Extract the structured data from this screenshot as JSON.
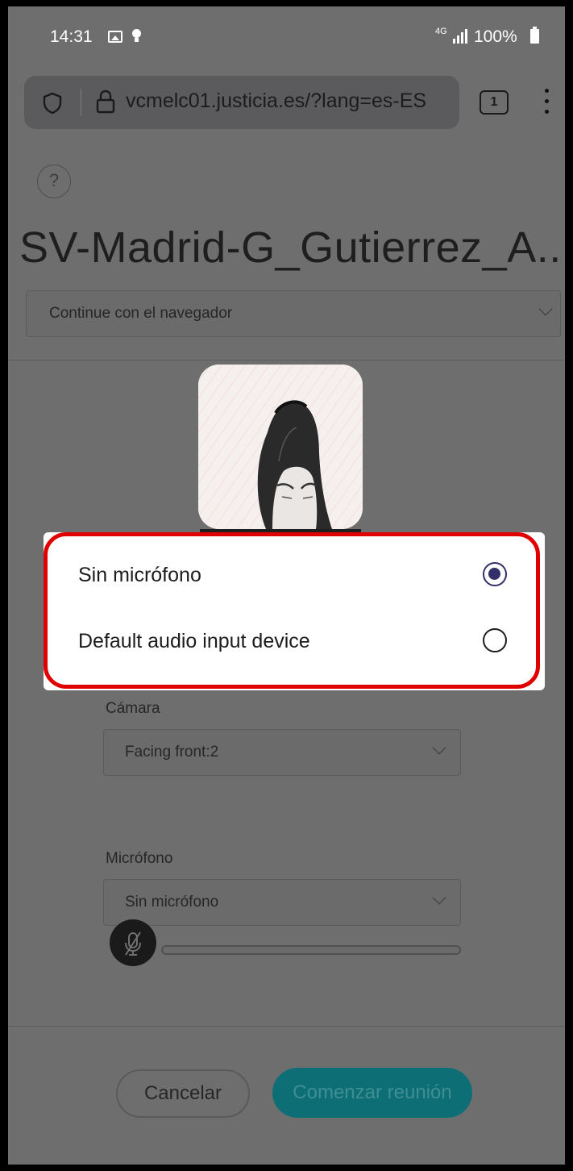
{
  "status_bar": {
    "time": "14:31",
    "network": "4G",
    "battery": "100%"
  },
  "browser": {
    "url": "vcmelc01.justicia.es/?lang=es-ES",
    "tab_count": "1"
  },
  "page": {
    "help_symbol": "?",
    "title": "SV-Madrid-G_Gutierrez_A...",
    "mode_select": "Continue con el navegador",
    "camera_label": "Cámara",
    "camera_value": "Facing front:2",
    "mic_label": "Micrófono",
    "mic_value": "Sin micrófono",
    "cancel_label": "Cancelar",
    "start_label": "Comenzar reunión"
  },
  "popup": {
    "options": [
      {
        "label": "Sin micrófono",
        "selected": true
      },
      {
        "label": "Default audio input device",
        "selected": false
      }
    ]
  },
  "colors": {
    "accent": "#322f69",
    "highlight_border": "#e00000",
    "start_button": "#0e6e76"
  },
  "icons": [
    "shield-icon",
    "lock-icon",
    "help-icon",
    "chevron-down-icon",
    "mic-muted-icon",
    "radio-icon"
  ]
}
